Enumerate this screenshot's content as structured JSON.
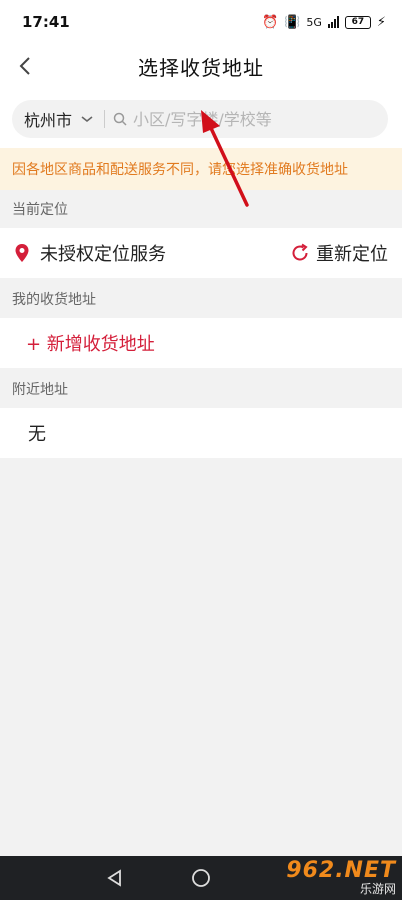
{
  "status_bar": {
    "time": "17:41",
    "network": "5G",
    "battery": "67"
  },
  "header": {
    "title": "选择收货地址",
    "back_icon": "chevron-left-icon"
  },
  "search": {
    "city": "杭州市",
    "placeholder": "小区/写字楼/学校等"
  },
  "notice": {
    "text": "因各地区商品和配送服务不同，请您选择准确收货地址"
  },
  "current_location": {
    "heading": "当前定位",
    "status": "未授权定位服务",
    "relocate_label": "重新定位"
  },
  "my_addresses": {
    "heading": "我的收货地址",
    "add_label": "+ 新增收货地址"
  },
  "nearby": {
    "heading": "附近地址",
    "empty_text": "无"
  },
  "watermark": {
    "main": "962.NET",
    "sub": "乐游网"
  },
  "colors": {
    "accent": "#d41f3a",
    "notice_text": "#e17a1f",
    "notice_bg": "#fdf3e0",
    "annotation_arrow": "#d10f1a"
  }
}
